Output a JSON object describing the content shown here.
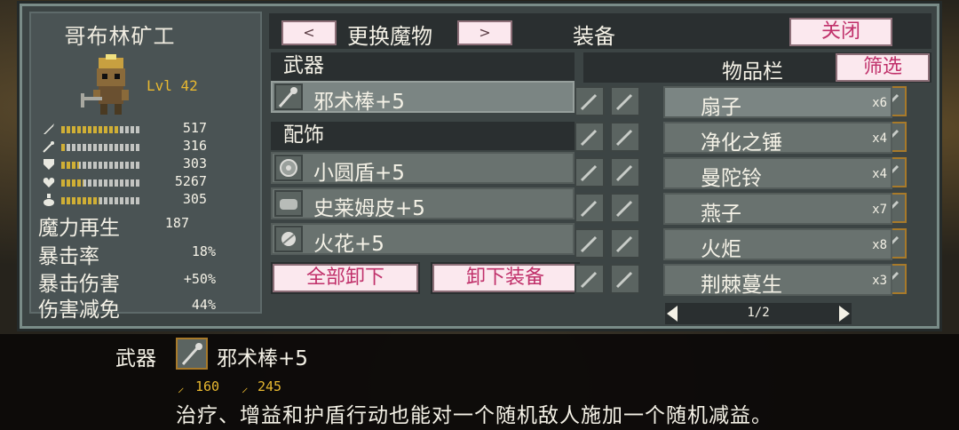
{
  "hero": {
    "name": "哥布林矿工",
    "level": "Lvl 42",
    "stats": [
      {
        "icon": "sword-icon",
        "value": "517",
        "fill": 0.72
      },
      {
        "icon": "wand-icon",
        "value": "316",
        "fill": 0.05
      },
      {
        "icon": "shield-icon",
        "value": "303",
        "fill": 0.22
      },
      {
        "icon": "heart-icon",
        "value": "5267",
        "fill": 0.28
      },
      {
        "icon": "flask-icon",
        "value": "305",
        "fill": 0.48
      }
    ],
    "attributes": [
      {
        "label": "魔力再生",
        "value": "187"
      },
      {
        "label": "暴击率",
        "value": "18%"
      },
      {
        "label": "暴击伤害",
        "value": "+50%"
      },
      {
        "label": "伤害减免",
        "value": "44%"
      }
    ]
  },
  "topbar": {
    "prev": "<",
    "change_monster": "更换魔物",
    "next": ">",
    "equipment": "装备",
    "close": "关闭"
  },
  "equipment": {
    "weapon_header": "武器",
    "weapon": "邪术棒+5",
    "accessory_header": "配饰",
    "accessories": [
      "小圆盾+5",
      "史莱姆皮+5",
      "火花+5"
    ],
    "unequip_all": "全部卸下",
    "unequip": "卸下装备"
  },
  "inventory": {
    "title": "物品栏",
    "filter": "筛选",
    "items": [
      {
        "name": "扇子",
        "qty": "x6",
        "icon": "fan-icon"
      },
      {
        "name": "净化之锤",
        "qty": "x4",
        "icon": "hammer-icon"
      },
      {
        "name": "曼陀铃",
        "qty": "x4",
        "icon": "mandolin-icon"
      },
      {
        "name": "燕子",
        "qty": "x7",
        "icon": "swallow-icon"
      },
      {
        "name": "火炬",
        "qty": "x8",
        "icon": "torch-icon"
      },
      {
        "name": "荆棘蔓生",
        "qty": "x3",
        "icon": "thorn-icon"
      }
    ],
    "page": "1/2"
  },
  "tooltip": {
    "kind": "武器",
    "name": "邪术棒+5",
    "attack": "160",
    "magic": "245",
    "description": "治疗、增益和护盾行动也能对一个随机敌人施加一个随机减益。"
  },
  "colors": {
    "accent": "#c0306a",
    "gold": "#e8b830",
    "panel": "#3c4444"
  }
}
